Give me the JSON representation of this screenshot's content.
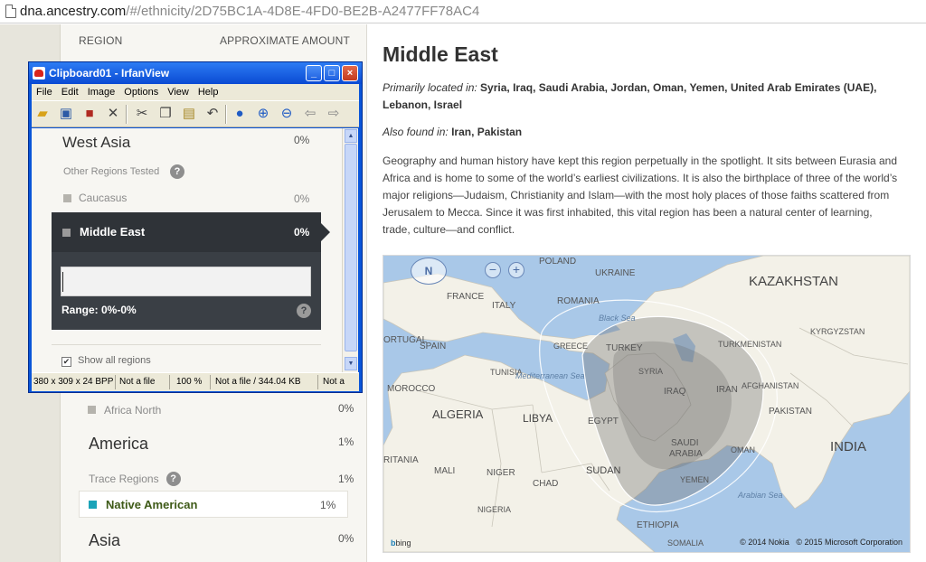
{
  "browser": {
    "url_host": "dna.ancestry.com",
    "url_path": "/#/ethnicity/2D75BC1A-4D8E-4FD0-BE2B-A2477FF78AC4"
  },
  "left_panel": {
    "header_region": "REGION",
    "header_amount": "APPROXIMATE AMOUNT",
    "rows": {
      "africa_north": {
        "label": "Africa North",
        "pct": "0%"
      },
      "america": {
        "label": "America",
        "pct": "1%"
      },
      "trace_regions": {
        "label": "Trace Regions",
        "pct": "1%"
      },
      "native_american": {
        "label": "Native American",
        "pct": "1%"
      },
      "asia": {
        "label": "Asia",
        "pct": "0%"
      }
    },
    "help_glyph": "?"
  },
  "irfanview": {
    "title": "Clipboard01 - IrfanView",
    "menu": [
      "File",
      "Edit",
      "Image",
      "Options",
      "View",
      "Help"
    ],
    "status": {
      "dims": "380 x 309 x 24 BPP",
      "file": "Not a file",
      "zoom": "100 %",
      "size": "Not a file / 344.04 KB",
      "extra": "Not a"
    },
    "content": {
      "west_asia": "West Asia",
      "west_asia_pct": "0%",
      "other_regions": "Other Regions Tested",
      "caucasus": "Caucasus",
      "caucasus_pct": "0%",
      "middle_east": "Middle East",
      "middle_east_pct": "0%",
      "range": "Range: 0%-0%",
      "show_all": "Show all regions"
    }
  },
  "main": {
    "title": "Middle East",
    "primarily_label": "Primarily located in:",
    "primarily_value": "Syria, Iraq, Saudi Arabia, Jordan, Oman, Yemen, United Arab Emirates (UAE), Lebanon, Israel",
    "also_label": "Also found in:",
    "also_value": "Iran, Pakistan",
    "description": "Geography and human history have kept this region perpetually in the spotlight. It sits between Eurasia and Africa and is home to some of the world’s earliest civilizations. It is also the birthplace of three of the world’s major religions—Judaism, Christianity and Islam—with the most holy places of those faiths scattered from Jerusalem to Mecca. Since it was first inhabited, this vital region has been a natural center of learning, trade, culture—and conflict."
  },
  "map": {
    "compass": "N",
    "zoom_out": "−",
    "zoom_in": "+",
    "labels": {
      "kazakhstan": "KAZAKHSTAN",
      "algeria": "ALGERIA",
      "libya": "LIBYA",
      "india": "INDIA",
      "sudan": "SUDAN",
      "mali": "MALI",
      "niger": "NIGER",
      "chad": "CHAD",
      "nigeria": "NIGERIA",
      "ethiopia": "ETHIOPIA",
      "somalia": "SOMALIA",
      "egypt": "EGYPT",
      "turkey": "TURKEY",
      "syria": "SYRIA",
      "iraq": "IRAQ",
      "iran": "IRAN",
      "saudi": "SAUDI",
      "arabia": "ARABIA",
      "oman": "OMAN",
      "yemen": "YEMEN",
      "pakistan": "PAKISTAN",
      "afghanistan": "AFGHANISTAN",
      "turkmenistan": "TURKMENISTAN",
      "kyrgyzstan": "KYRGYZSTAN",
      "france": "FRANCE",
      "spain": "SPAIN",
      "portugal": "ORTUGAL",
      "italy": "ITALY",
      "greece": "GREECE",
      "romania": "ROMANIA",
      "ukraine": "UKRAINE",
      "poland": "POLAND",
      "morocco": "MOROCCO",
      "tunisia": "TUNISIA",
      "mauritania": "RITANIA",
      "black_sea": "Black Sea",
      "med_sea": "Mediterranean Sea",
      "arabian_sea": "Arabian Sea"
    },
    "bing": "bing",
    "copyright_nokia": "© 2014 Nokia",
    "copyright_ms": "© 2015 Microsoft Corporation"
  },
  "colors": {
    "accent_teal": "#1aa3b8",
    "card_dark": "#3a3f45",
    "window_blue": "#0a55d9"
  }
}
